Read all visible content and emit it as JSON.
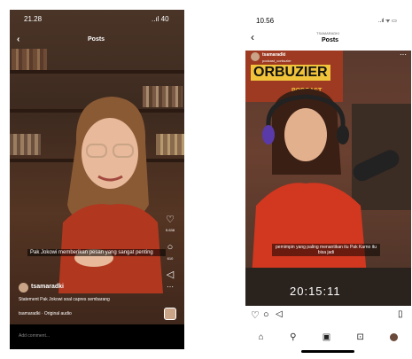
{
  "left_phone": {
    "status_time": "21.28",
    "status_right": "..ıl 40",
    "title": "Posts",
    "likes": "5.638",
    "comments": "610",
    "caption": "Pak Jokowi memberikan pesan yang sangat penting",
    "username": "tsamaradki",
    "description": "Statement Pak Jokowi soal capres sembarang",
    "audio": "tsamaradki · Original audio",
    "comment_placeholder": "Add comment..."
  },
  "right_phone": {
    "status_time": "10.56",
    "status_right": "..ıl ᯤ ▭",
    "header_user": "TSAMARADKI",
    "title": "Posts",
    "username": "tsamaradki",
    "subtitle": "podcast_corbuzier",
    "podcast_name": "ORBUZIER",
    "podcast_word": "PODCAST",
    "caption": "pemimpin yang paling menantikan itu Pak Karno itu bisa jadi",
    "timestamp": "20:15:11"
  }
}
